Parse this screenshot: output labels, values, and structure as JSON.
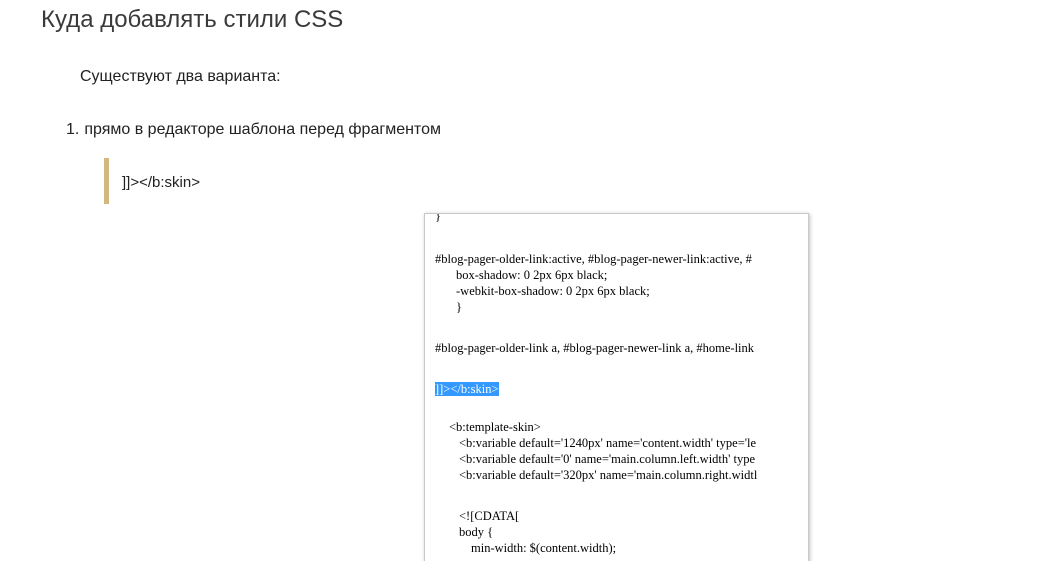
{
  "header": {
    "title": "Куда добавлять стили CSS"
  },
  "intro": {
    "text": "Существуют два варианта:"
  },
  "list": {
    "items": [
      {
        "number": "1.",
        "text": "прямо в редакторе шаблона перед фрагментом"
      }
    ]
  },
  "quote": {
    "text": "]]></b:skin>"
  },
  "screenshot": {
    "lines": [
      "}",
      "#blog-pager-older-link:active, #blog-pager-newer-link:active, #",
      "box-shadow: 0 2px 6px black;",
      "-webkit-box-shadow: 0 2px 6px black;",
      "}",
      "#blog-pager-older-link a, #blog-pager-newer-link a, #home-link",
      "]]></b:skin>",
      "<b:template-skin>",
      "<b:variable default='1240px' name='content.width' type='le",
      "<b:variable default='0' name='main.column.left.width' type",
      "<b:variable default='320px' name='main.column.right.widtl",
      "<![CDATA[",
      "body {",
      "min-width: $(content.width);"
    ]
  },
  "colors": {
    "quote_border": "#d4b77e",
    "selection_highlight": "#3399ff",
    "title": "#3a3a3a"
  }
}
